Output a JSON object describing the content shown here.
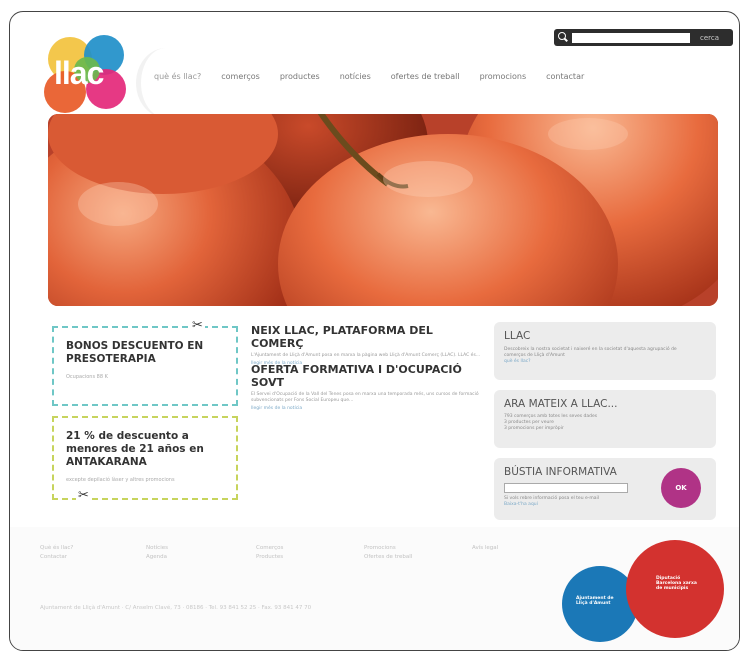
{
  "logo": {
    "text": "llac",
    "colors": [
      "#e85a27",
      "#1f8fc9",
      "#6ab84e",
      "#e4287a",
      "#f2c23d"
    ]
  },
  "nav": {
    "items": [
      "què és llac?",
      "comerços",
      "productes",
      "notícies",
      "ofertes de treball",
      "promocions",
      "contactar"
    ]
  },
  "search": {
    "placeholder": "",
    "button": "cerca"
  },
  "coupons": [
    {
      "title": "BONOS DESCUENTO EN PRESOTERAPIA",
      "sub": "Ocupacions 88 K"
    },
    {
      "title": "21 % de descuento a menores de 21 años en ANTAKARANA",
      "sub": "excepte depilació làser y altres promocions"
    }
  ],
  "news": [
    {
      "title": "NEIX LLAC, PLATAFORMA DEL COMERÇ",
      "body": "L'Ajuntament de Lliçà d'Amunt posa en marxa la pàgina web Lliçà d'Amunt Comerç (LLAC). LLAC és...",
      "more": "llegir més de la notícia"
    },
    {
      "title": "OFERTA FORMATIVA I D'OCUPACIÓ SOVT",
      "body": "El Servei d'Ocupació de la Vall del Tenes posa en marxa una temporada més, uns cursos de formació subvencionats per Fons Social Europeu que...",
      "more": "llegir més de la notícia"
    }
  ],
  "side": {
    "llac": {
      "title": "LLAC",
      "body": "Descobreix la nostra societat i naixeré en la societat d'aquesta agrupació de comerços de Lliçà d'Amunt",
      "more": "què és llac?"
    },
    "ara": {
      "title": "ARA MATEIX A LLAC...",
      "lines": [
        "793 comerços amb totes les seves dades",
        "3 productes per veure",
        "3 promocions per impròpir"
      ]
    },
    "bustia": {
      "title": "BÚSTIA INFORMATIVA",
      "body": "Si vols rebre informació posa el teu e-mail",
      "more": "Baixa-t'ha aquí",
      "ok": "OK"
    }
  },
  "footer": {
    "cols": [
      [
        "Què és llac?",
        "Contactar"
      ],
      [
        "Notícies",
        "Agenda"
      ],
      [
        "Comerços",
        "Productes"
      ],
      [
        "Promocions",
        "Ofertes de treball"
      ],
      [
        "Avís legal"
      ]
    ],
    "address": "Ajuntament de Lliçà d'Amunt · C/ Anselm Clavé, 73 · 08186 · Tel. 93 841 52 25 · Fax. 93 841 47 70",
    "badge_blue": "Ajuntament de Lliçà d'Amunt",
    "badge_red": "Diputació Barcelona xarxa de municipis"
  },
  "colors": {
    "coupon1": "#6fc7c6",
    "coupon2": "#c7d45d",
    "ok": "#b03386",
    "badge_blue": "#1b78b7",
    "badge_red": "#d3322f"
  }
}
